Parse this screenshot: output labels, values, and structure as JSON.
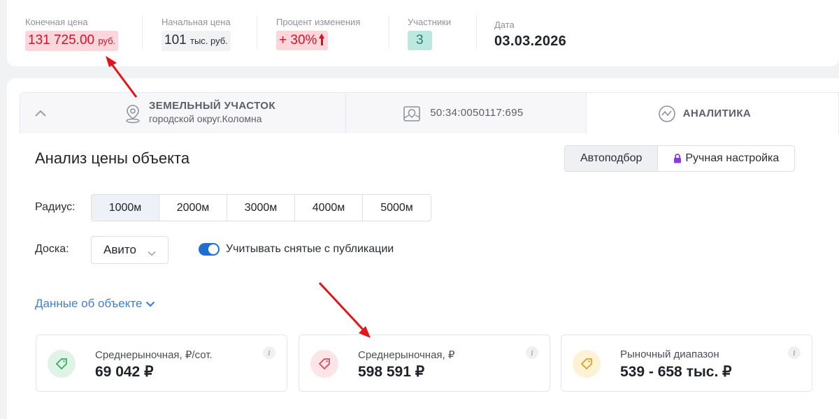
{
  "stats": {
    "final_price": {
      "label": "Конечная цена",
      "value": "131 725.00",
      "unit": "руб."
    },
    "start_price": {
      "label": "Начальная цена",
      "value": "101",
      "unit": "тыс. руб."
    },
    "change": {
      "label": "Процент изменения",
      "value": "+ 30%"
    },
    "participants": {
      "label": "Участники",
      "value": "3"
    },
    "date": {
      "label": "Дата",
      "value": "03.03.2026"
    }
  },
  "tabs": [
    {
      "title": "ЗЕМЕЛЬНЫЙ УЧАСТОК",
      "subtitle": "городской округ.Коломна",
      "icon": "location-pin-icon"
    },
    {
      "title": "50:34:0050117:695",
      "icon": "map-pin-icon"
    },
    {
      "title": "АНАЛИТИКА",
      "icon": "analytics-icon"
    }
  ],
  "analysis": {
    "title": "Анализ цены объекта",
    "modes": [
      "Автоподбор",
      "Ручная настройка"
    ],
    "active_mode": "Автоподбор",
    "radius_label": "Радиус:",
    "radius_options": [
      "1000м",
      "2000м",
      "3000м",
      "4000м",
      "5000м"
    ],
    "active_radius": "1000м",
    "board_label": "Доска:",
    "board_value": "Авито",
    "toggle_label": "Учитывать снятые с публикации",
    "toggle_on": true,
    "object_data_link": "Данные об объекте"
  },
  "metrics": [
    {
      "label": "Среднерыночная, ₽/сот.",
      "value": "69 042 ₽",
      "color": "#dff4e6"
    },
    {
      "label": "Среднерыночная, ₽",
      "value": "598 591 ₽",
      "color": "#fde4e6"
    },
    {
      "label": "Рыночный диапазон",
      "value": "539 - 658 тыс. ₽",
      "color": "#fdf1d6"
    }
  ],
  "colors": {
    "accent_red": "#d0142a",
    "link_blue": "#3d7fd6",
    "toggle_blue": "#1f6fd0",
    "annotation_red": "#e3151b"
  }
}
